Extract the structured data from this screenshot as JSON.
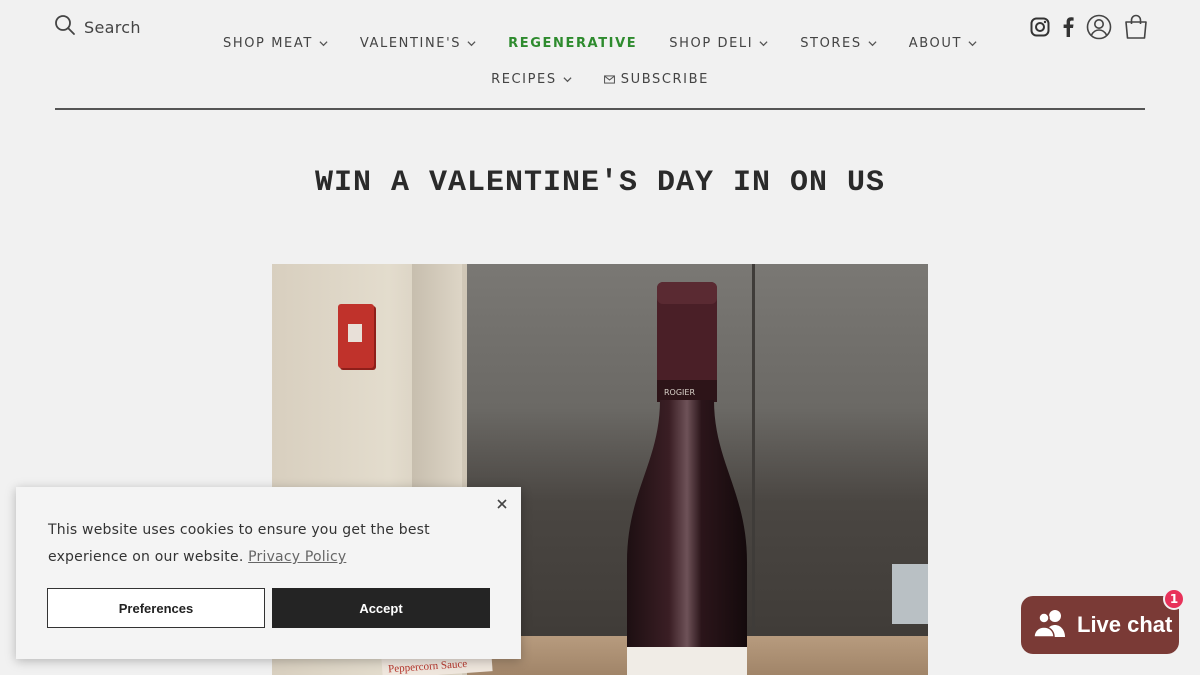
{
  "header": {
    "search_label": "Search",
    "icons": [
      "search-icon",
      "instagram-icon",
      "facebook-icon",
      "account-icon",
      "cart-icon"
    ]
  },
  "nav": {
    "row1": [
      {
        "label": "SHOP MEAT",
        "dropdown": true
      },
      {
        "label": "VALENTINE'S",
        "dropdown": true
      },
      {
        "label": "REGENERATIVE",
        "dropdown": false
      },
      {
        "label": "SHOP DELI",
        "dropdown": true
      },
      {
        "label": "STORES",
        "dropdown": true
      },
      {
        "label": "ABOUT",
        "dropdown": true
      }
    ],
    "row2": [
      {
        "label": "RECIPES",
        "dropdown": true
      },
      {
        "label": "SUBSCRIBE",
        "dropdown": false
      }
    ],
    "highlight_color": "#2e8b2e"
  },
  "main": {
    "title": "WIN A VALENTINE'S DAY IN ON US",
    "photo": {
      "bottle_label": "ROGIER",
      "sauce_label": "Peppercorn Sauce"
    }
  },
  "cookie_banner": {
    "text": "This website uses cookies to ensure you get the best experience on our website.",
    "link": "Privacy Policy",
    "preferences_label": "Preferences",
    "accept_label": "Accept"
  },
  "chat": {
    "label": "Live chat",
    "badge": "1",
    "color": "#7a3a36"
  }
}
